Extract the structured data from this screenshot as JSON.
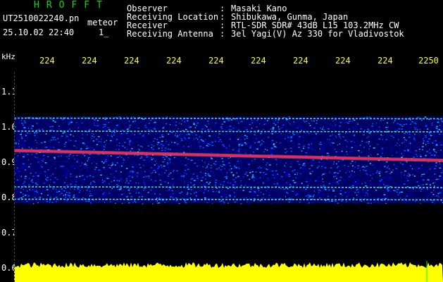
{
  "header": {
    "app_title": "HROFFT",
    "file_name": "UT2510022240.pn",
    "mode": "meteor",
    "datetime": "25.10.02 22:40",
    "page_marker": "1_"
  },
  "info": [
    {
      "label": "Observer",
      "value": "Masaki Kano"
    },
    {
      "label": "Receiving Location",
      "value": "Shibukawa, Gunma, Japan"
    },
    {
      "label": "Receiver",
      "value": "RTL-SDR SDR# 43dB L15 103.2MHz CW"
    },
    {
      "label": "Receiving Antenna",
      "value": "3el Yagi(V) Az 330 for Vladivostok"
    }
  ],
  "separator": ":",
  "spectrogram": {
    "unit_label": "kHz",
    "time_ticks": [
      "224",
      "224",
      "224",
      "224",
      "224",
      "224",
      "224",
      "224",
      "224",
      "2250"
    ],
    "freq_ticks": [
      "1.1",
      "1.0",
      "0.9",
      "0.8",
      "0.7",
      "0.6"
    ],
    "freq_range_khz": [
      0.59,
      1.17
    ],
    "noise_band_khz": [
      0.783,
      1.03
    ],
    "carrier_khz": 0.925,
    "secondary_lines_khz": [
      1.025,
      0.988,
      0.83,
      0.795
    ],
    "colors": {
      "background": "#000000",
      "noise_low": "#0000c0",
      "noise_mid": "#0060ff",
      "line": "#40ffc0",
      "carrier": "#ff2060",
      "footer": "#ffff00"
    }
  }
}
